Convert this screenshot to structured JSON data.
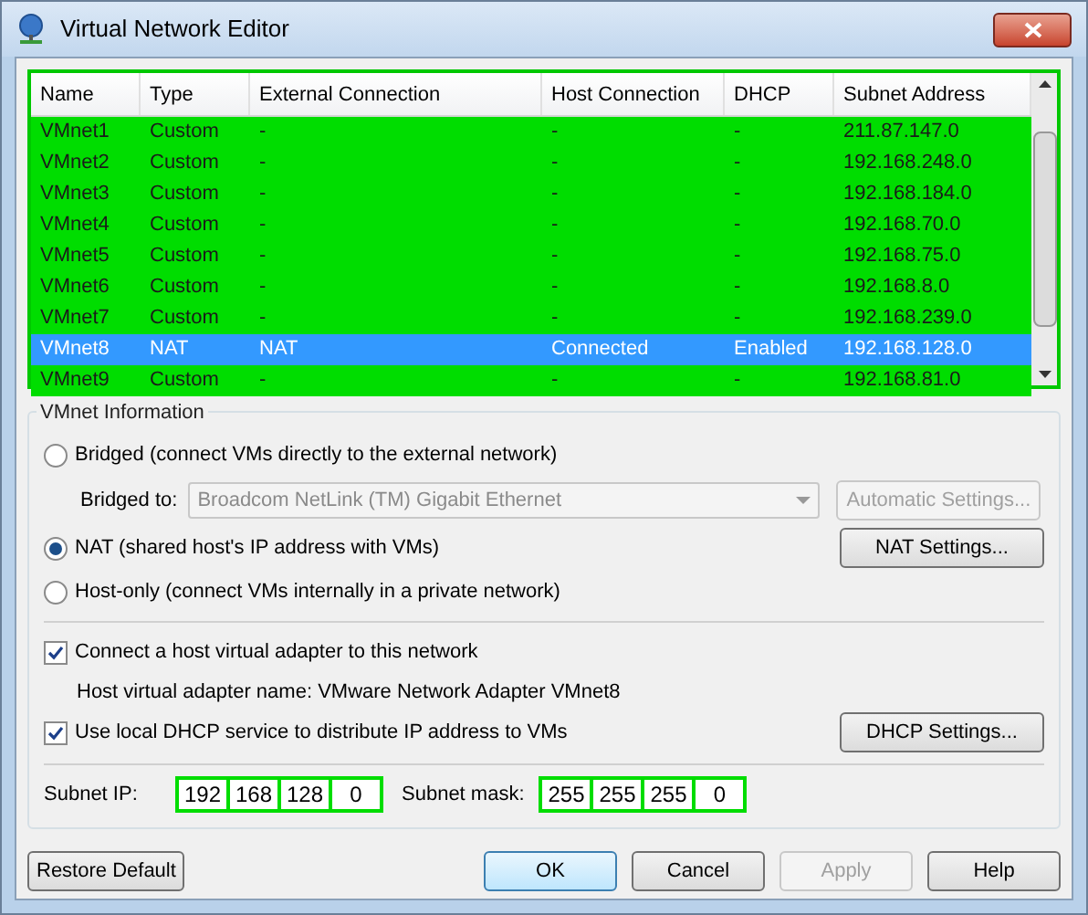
{
  "window": {
    "title": "Virtual Network Editor"
  },
  "table": {
    "columns": [
      "Name",
      "Type",
      "External Connection",
      "Host Connection",
      "DHCP",
      "Subnet Address"
    ],
    "rows": [
      {
        "cells": [
          "VMnet1",
          "Custom",
          "-",
          "-",
          "-",
          "211.87.147.0"
        ],
        "selected": false
      },
      {
        "cells": [
          "VMnet2",
          "Custom",
          "-",
          "-",
          "-",
          "192.168.248.0"
        ],
        "selected": false
      },
      {
        "cells": [
          "VMnet3",
          "Custom",
          "-",
          "-",
          "-",
          "192.168.184.0"
        ],
        "selected": false
      },
      {
        "cells": [
          "VMnet4",
          "Custom",
          "-",
          "-",
          "-",
          "192.168.70.0"
        ],
        "selected": false
      },
      {
        "cells": [
          "VMnet5",
          "Custom",
          "-",
          "-",
          "-",
          "192.168.75.0"
        ],
        "selected": false
      },
      {
        "cells": [
          "VMnet6",
          "Custom",
          "-",
          "-",
          "-",
          "192.168.8.0"
        ],
        "selected": false
      },
      {
        "cells": [
          "VMnet7",
          "Custom",
          "-",
          "-",
          "-",
          "192.168.239.0"
        ],
        "selected": false
      },
      {
        "cells": [
          "VMnet8",
          "NAT",
          "NAT",
          "Connected",
          "Enabled",
          "192.168.128.0"
        ],
        "selected": true
      },
      {
        "cells": [
          "VMnet9",
          "Custom",
          "-",
          "-",
          "-",
          "192.168.81.0"
        ],
        "selected": false
      }
    ]
  },
  "vmnet_info": {
    "title": "VMnet Information",
    "modes": [
      {
        "label": "Bridged (connect VMs directly to the external network)",
        "selected": false
      },
      {
        "label": "NAT (shared host's IP address with VMs)",
        "selected": true
      },
      {
        "label": "Host-only (connect VMs internally in a private network)",
        "selected": false
      }
    ],
    "bridged_to": {
      "label": "Bridged to:",
      "value": "Broadcom NetLink (TM) Gigabit Ethernet",
      "disabled": true
    },
    "automatic_settings": {
      "label": "Automatic Settings...",
      "disabled": true
    },
    "nat_settings": {
      "label": "NAT Settings..."
    },
    "connect_adapter": {
      "label": "Connect a host virtual adapter to this network",
      "checked": true
    },
    "adapter_name": "Host virtual adapter name: VMware Network Adapter VMnet8",
    "use_dhcp": {
      "label": "Use local DHCP service to distribute IP address to VMs",
      "checked": true
    },
    "dhcp_settings": {
      "label": "DHCP Settings..."
    },
    "subnet_ip": {
      "label": "Subnet IP:",
      "octets": [
        "192",
        "168",
        "128",
        "0"
      ]
    },
    "subnet_mask": {
      "label": "Subnet mask:",
      "octets": [
        "255",
        "255",
        "255",
        "0"
      ]
    }
  },
  "buttons": [
    {
      "label": "Restore Default",
      "disabled": false
    },
    {
      "label": "OK",
      "disabled": false
    },
    {
      "label": "Cancel",
      "disabled": false
    },
    {
      "label": "Apply",
      "disabled": true
    },
    {
      "label": "Help",
      "disabled": false
    }
  ]
}
